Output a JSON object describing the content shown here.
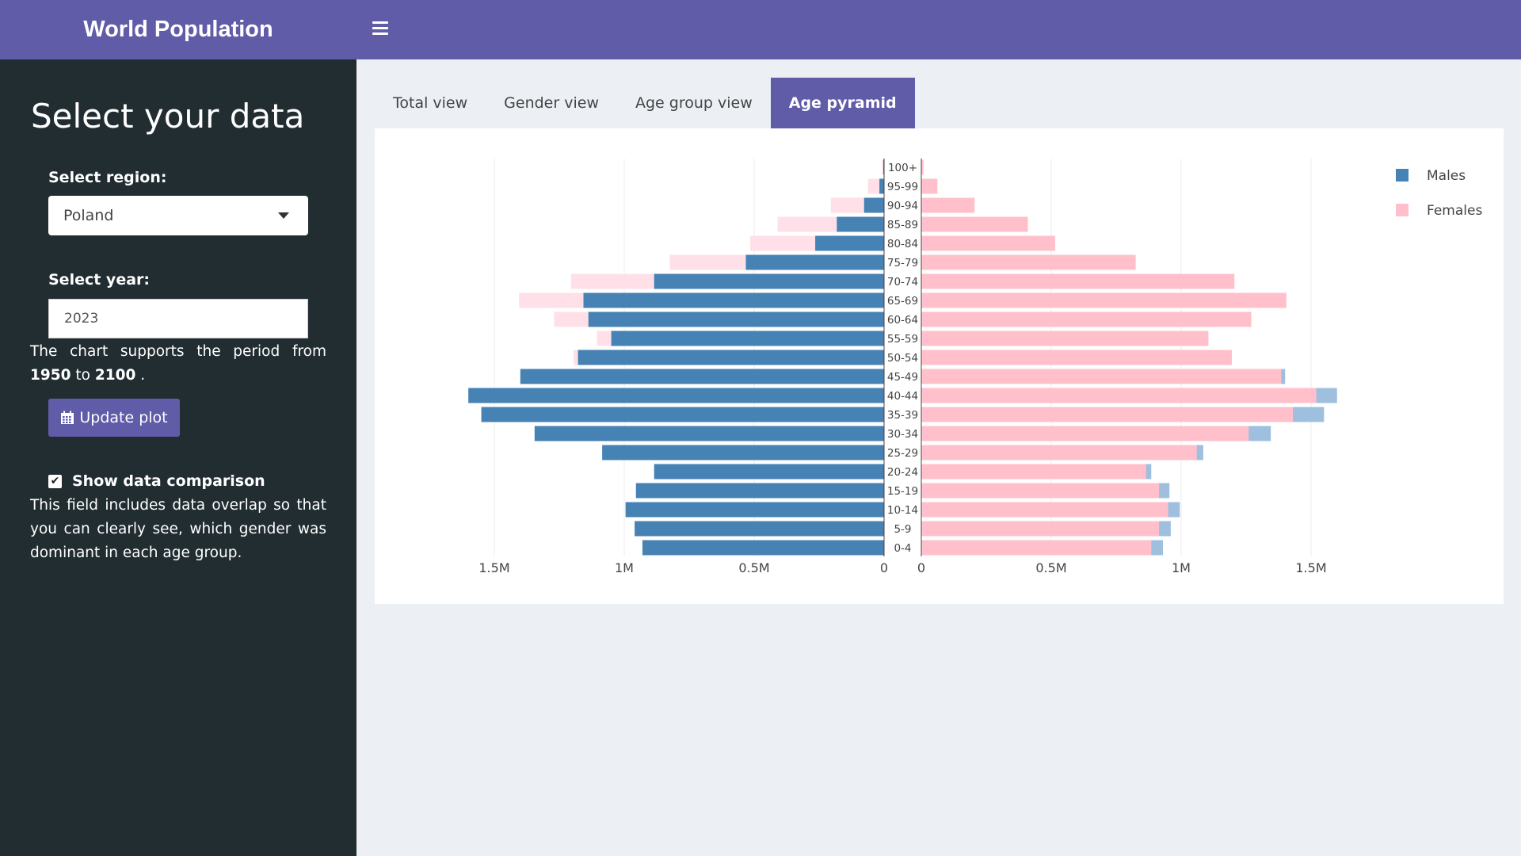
{
  "app": {
    "title": "World Population"
  },
  "sidebar": {
    "heading": "Select your data",
    "region_label": "Select region:",
    "region_value": "Poland",
    "year_label": "Select year:",
    "year_value": "2023",
    "period_prefix": "The chart supports the period from ",
    "period_start": "1950",
    "period_mid": " to ",
    "period_end": "2100",
    "period_suffix": " .",
    "update_button": "Update plot",
    "compare_label": "Show data comparison",
    "compare_checked": true,
    "compare_desc": "This field includes data overlap so that you can clearly see, which gender was dominant in each age group."
  },
  "tabs": [
    {
      "label": "Total view",
      "active": false
    },
    {
      "label": "Gender view",
      "active": false
    },
    {
      "label": "Age group view",
      "active": false
    },
    {
      "label": "Age pyramid",
      "active": true
    }
  ],
  "chart_data": {
    "type": "bar",
    "orientation": "horizontal-pyramid",
    "categories": [
      "0-4",
      "5-9",
      "10-14",
      "15-19",
      "20-24",
      "25-29",
      "30-34",
      "35-39",
      "40-44",
      "45-49",
      "50-54",
      "55-59",
      "60-64",
      "65-69",
      "70-74",
      "75-79",
      "80-84",
      "85-89",
      "90-94",
      "95-99",
      "100+"
    ],
    "series": [
      {
        "name": "Males",
        "color": "#4682b4",
        "values": [
          930000,
          960000,
          995000,
          955000,
          885000,
          1085000,
          1345000,
          1550000,
          1600000,
          1400000,
          1178000,
          1050000,
          1138000,
          1157000,
          885000,
          532000,
          265000,
          182000,
          77000,
          18000,
          3000
        ]
      },
      {
        "name": "Females",
        "color": "#ffc0cb",
        "values": [
          885000,
          915000,
          950000,
          915000,
          865000,
          1060000,
          1260000,
          1430000,
          1520000,
          1385000,
          1195000,
          1105000,
          1270000,
          1405000,
          1205000,
          825000,
          515000,
          410000,
          205000,
          62000,
          8000
        ]
      }
    ],
    "x_ticks": [
      "1.5M",
      "1M",
      "0.5M",
      "0",
      "0",
      "0.5M",
      "1M",
      "1.5M"
    ],
    "xlim": [
      0,
      1650000
    ],
    "legend_position": "top-right",
    "comparison_overlay": true,
    "overlay_colors": {
      "male_overlay": "#9fbfdf",
      "female_overlay": "#ffe0e8"
    },
    "grid": true
  }
}
